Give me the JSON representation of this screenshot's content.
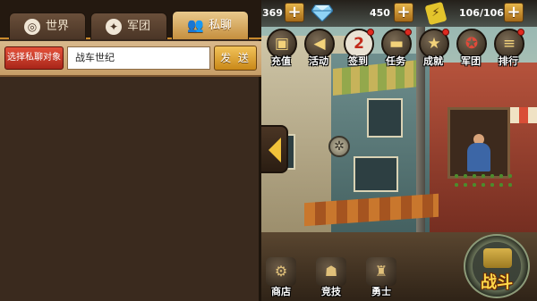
{
  "chat": {
    "tabs": [
      {
        "label": "世界",
        "icon": "globe-icon"
      },
      {
        "label": "军团",
        "icon": "legion-emblem-icon"
      },
      {
        "label": "私聊",
        "icon": "people-icon"
      }
    ],
    "active_tab": "私聊",
    "select_target_label": "选择私聊对象",
    "target_value": "战车世纪",
    "send_label": "发 送"
  },
  "resources": {
    "gold": "369",
    "diamonds": "450",
    "energy": "106/106"
  },
  "top_menu": [
    {
      "label": "充值",
      "icon": "treasure-chest-icon"
    },
    {
      "label": "活动",
      "icon": "megaphone-icon"
    },
    {
      "label": "签到",
      "icon": "calendar-icon",
      "badge": "2"
    },
    {
      "label": "任务",
      "icon": "tank-icon"
    },
    {
      "label": "成就",
      "icon": "star-medal-icon"
    },
    {
      "label": "军团",
      "icon": "wings-emblem-icon"
    },
    {
      "label": "排行",
      "icon": "rank-board-icon"
    }
  ],
  "bottom_menu": [
    {
      "label": "商店",
      "icon": "shop-icon"
    },
    {
      "label": "竞技",
      "icon": "arena-icon"
    },
    {
      "label": "勇士",
      "icon": "warrior-icon"
    }
  ],
  "battle_label": "战斗",
  "colors": {
    "accent": "#f0c23a",
    "active_tab": "#c58f3e",
    "select_button": "#e4513a",
    "send_button": "#f2c35a",
    "panel_bg": "#3a2a1e"
  }
}
